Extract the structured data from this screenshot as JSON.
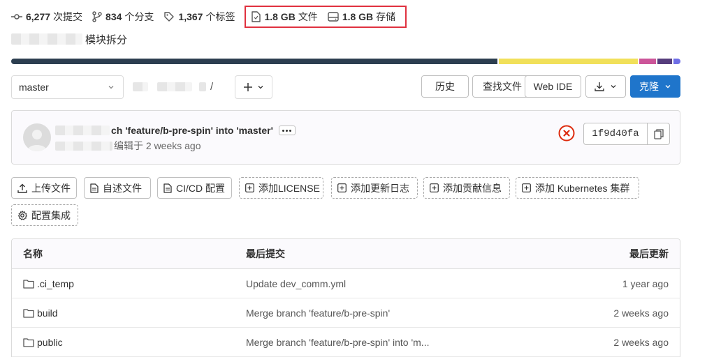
{
  "stats": {
    "commits": {
      "value": "6,277",
      "label": "次提交"
    },
    "branches": {
      "value": "834",
      "label": "个分支"
    },
    "tags": {
      "value": "1,367",
      "label": "个标签"
    },
    "files": {
      "value": "1.8 GB",
      "label": "文件"
    },
    "storage": {
      "value": "1.8 GB",
      "label": "存储"
    }
  },
  "description": {
    "suffix": "模块拆分"
  },
  "language_bar": {
    "segments": [
      {
        "color": "#2c3e50",
        "share": 73.3
      },
      {
        "color": "#f1e05a",
        "share": 20.9
      },
      {
        "color": "#cc5599",
        "share": 2.5
      },
      {
        "color": "#563d7c",
        "share": 2.3
      },
      {
        "color": "#6e6ee6",
        "share": 1.0
      }
    ]
  },
  "toolbar": {
    "branch": "master",
    "separator": "/",
    "history": "历史",
    "find_file": "查找文件",
    "web_ide": "Web IDE",
    "clone": "克隆"
  },
  "commit": {
    "title": "ch 'feature/b-pre-spin' into 'master'",
    "meta": "编辑于 2 weeks ago",
    "sha": "1f9d40fa",
    "status_color": "#dd2b0e"
  },
  "actions": {
    "upload": "上传文件",
    "readme": "自述文件",
    "cicd": "CI/CD 配置",
    "license": "添加LICENSE",
    "changelog": "添加更新日志",
    "contributing": "添加贡献信息",
    "kubernetes": "添加 Kubernetes 集群",
    "integrations": "配置集成"
  },
  "table": {
    "headers": {
      "name": "名称",
      "last_commit": "最后提交",
      "last_update": "最后更新"
    },
    "rows": [
      {
        "name": ".ci_temp",
        "commit": "Update dev_comm.yml",
        "updated": "1 year ago"
      },
      {
        "name": "build",
        "commit": "Merge branch 'feature/b-pre-spin'",
        "updated": "2 weeks ago"
      },
      {
        "name": "public",
        "commit": "Merge branch 'feature/b-pre-spin' into 'm...",
        "updated": "2 weeks ago"
      }
    ]
  }
}
